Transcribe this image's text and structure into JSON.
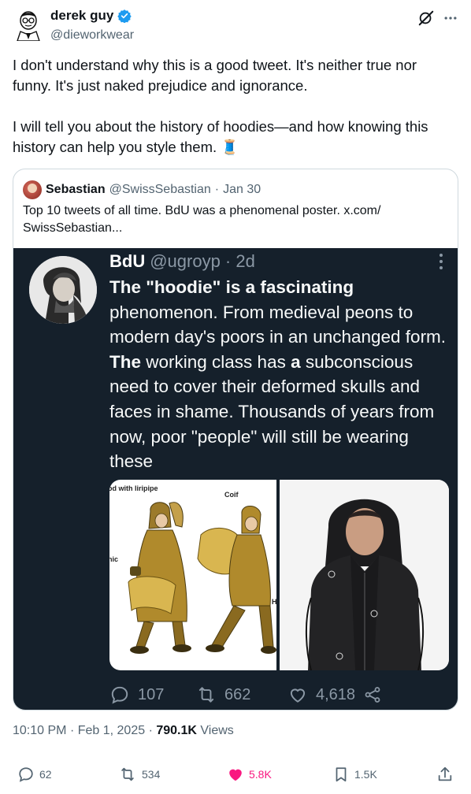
{
  "author": {
    "display_name": "derek guy",
    "handle": "@dieworkwear",
    "verified_color": "#1d9bf0",
    "avatar_icon": "illustrated-portrait"
  },
  "tweet": {
    "paragraphs": [
      "I don't understand why this is a good tweet. It's neither true nor funny. It's just naked prejudice and ignorance.",
      "I will tell you about the history of hoodies—and how knowing this history can help you style them. 🧵"
    ]
  },
  "quoted": {
    "display_name": "Sebastian",
    "handle": "@SwissSebastian",
    "separator": "·",
    "date": "Jan 30",
    "text": "Top 10 tweets of all time. BdU was a phenomenal poster.  x.com/ SwissSebastian..."
  },
  "image": {
    "name": "BdU",
    "handle_time": "@ugroyp · 2d",
    "text_segments": [
      {
        "t": "The \"hoodie\" is a fascinating",
        "bold": true
      },
      {
        "t": " phenomenon. From medieval peons to modern day's poors in an unchanged form. ",
        "bold": false
      },
      {
        "t": "The",
        "bold": true
      },
      {
        "t": " working class has ",
        "bold": false
      },
      {
        "t": "a",
        "bold": true
      },
      {
        "t": " subconscious need to cover their deformed skulls and faces in shame. Thousands of years from now, poor \"people\" will still be wearing these",
        "bold": false
      }
    ],
    "label_hood": "od with liripipe",
    "label_coif": "Coif",
    "label_tunic": "nic",
    "label_h": "H",
    "replies": "107",
    "retweets": "662",
    "likes": "4,618"
  },
  "meta": {
    "time": "10:10 PM",
    "date": "Feb 1, 2025",
    "views_count": "790.1K",
    "views_label": "Views",
    "dot": "·"
  },
  "actions": {
    "replies": "62",
    "retweets": "534",
    "likes": "5.8K",
    "bookmarks": "1.5K",
    "like_color": "#f91880"
  }
}
